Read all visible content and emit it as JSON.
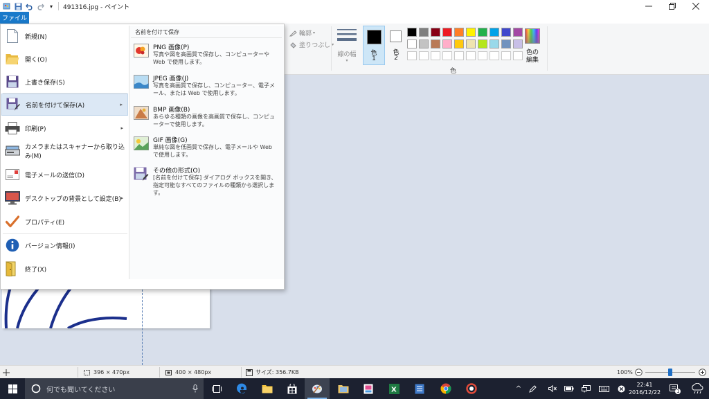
{
  "window": {
    "title": "491316.jpg - ペイント"
  },
  "ribbon": {
    "file_tab_label": "ファイル",
    "outline_label": "輪郭",
    "fill_label": "塗りつぶし",
    "line_width_label": "線の幅",
    "color1_label": "色",
    "color1_num": "1",
    "color2_label": "色",
    "color2_num": "2",
    "colors_group_label": "色",
    "edit_colors_label_1": "色の",
    "edit_colors_label_2": "編集",
    "palette_row1": [
      "#000000",
      "#7f7f7f",
      "#880015",
      "#ed1c24",
      "#ff7f27",
      "#fff200",
      "#22b14c",
      "#00a2e8",
      "#3f48cc",
      "#a349a4"
    ],
    "palette_row2": [
      "#ffffff",
      "#c3c3c3",
      "#b97a57",
      "#ffaec9",
      "#ffc90e",
      "#efe4b0",
      "#b5e61d",
      "#99d9ea",
      "#7092be",
      "#c8bfe7"
    ]
  },
  "file_menu": {
    "items": [
      {
        "label": "新規(N)",
        "icon": "new-file-icon"
      },
      {
        "label": "開く(O)",
        "icon": "open-folder-icon"
      },
      {
        "label": "上書き保存(S)",
        "icon": "save-icon"
      },
      {
        "label": "名前を付けて保存(A)",
        "icon": "save-as-icon",
        "arrow": "▸"
      },
      {
        "label": "印刷(P)",
        "icon": "printer-icon",
        "arrow": "▸"
      },
      {
        "label": "カメラまたはスキャナーから取り込み(M)",
        "icon": "scanner-icon"
      },
      {
        "label": "電子メールの送信(D)",
        "icon": "email-icon"
      },
      {
        "label": "デスクトップの背景として設定(B)",
        "icon": "desktop-background-icon",
        "arrow": "▸"
      },
      {
        "label": "プロパティ(E)",
        "icon": "checkmark-icon"
      },
      {
        "label": "バージョン情報(I)",
        "icon": "info-icon"
      },
      {
        "label": "終了(X)",
        "icon": "exit-icon"
      }
    ],
    "submenu": {
      "heading": "名前を付けて保存",
      "items": [
        {
          "title": "PNG 画像(P)",
          "desc": "写真や図を高画質で保存し、コンピューターや Web で使用します。",
          "icon": "png-image-icon"
        },
        {
          "title": "JPEG 画像(J)",
          "desc": "写真を高画質で保存し、コンピューター、電子メール、または Web で使用します。",
          "icon": "jpeg-image-icon"
        },
        {
          "title": "BMP 画像(B)",
          "desc": "あらゆる種類の画像を高画質で保存し、コンピューターで使用します。",
          "icon": "bmp-image-icon"
        },
        {
          "title": "GIF 画像(G)",
          "desc": "単純な図を低画質で保存し、電子メールや Web で使用します。",
          "icon": "gif-image-icon"
        },
        {
          "title": "その他の形式(O)",
          "desc": "[名前を付けて保存] ダイアログ ボックスを開き、指定可能なすべてのファイルの種類から選択します。",
          "icon": "other-formats-icon"
        }
      ]
    }
  },
  "statusbar": {
    "selection_size": "396 × 470px",
    "image_size": "400 × 480px",
    "file_size": "サイズ: 356.7KB",
    "zoom": "100%",
    "zoom_level": 1.0
  },
  "taskbar": {
    "search_placeholder": "何でも聞いてください",
    "time": "22:41",
    "date": "2016/12/22",
    "notification_count": "1"
  }
}
